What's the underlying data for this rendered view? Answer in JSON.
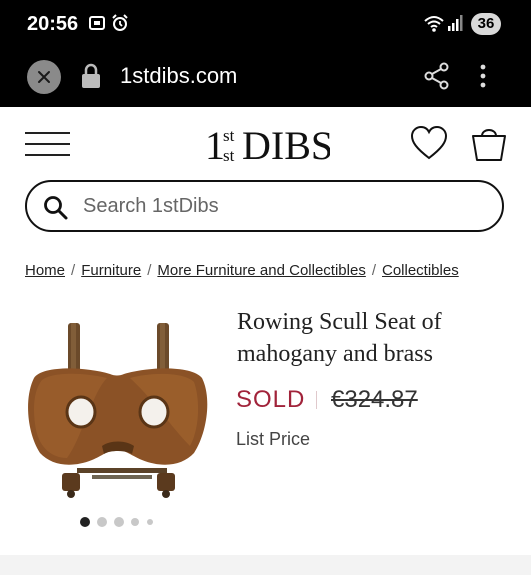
{
  "status_bar": {
    "time": "20:56",
    "battery": "36"
  },
  "browser": {
    "url": "1stdibs.com"
  },
  "header": {
    "logo_text": "1stDIBS"
  },
  "search": {
    "placeholder": "Search 1stDibs"
  },
  "breadcrumb": [
    "Home",
    "Furniture",
    "More Furniture and Collectibles",
    "Collectibles"
  ],
  "product": {
    "title": "Rowing Scull Seat of mahogany and brass",
    "status": "SOLD",
    "price": "€324.87",
    "price_label": "List Price",
    "image_count": 5,
    "active_image": 1
  },
  "colors": {
    "sold": "#a1233a",
    "topbar": "#000000"
  }
}
